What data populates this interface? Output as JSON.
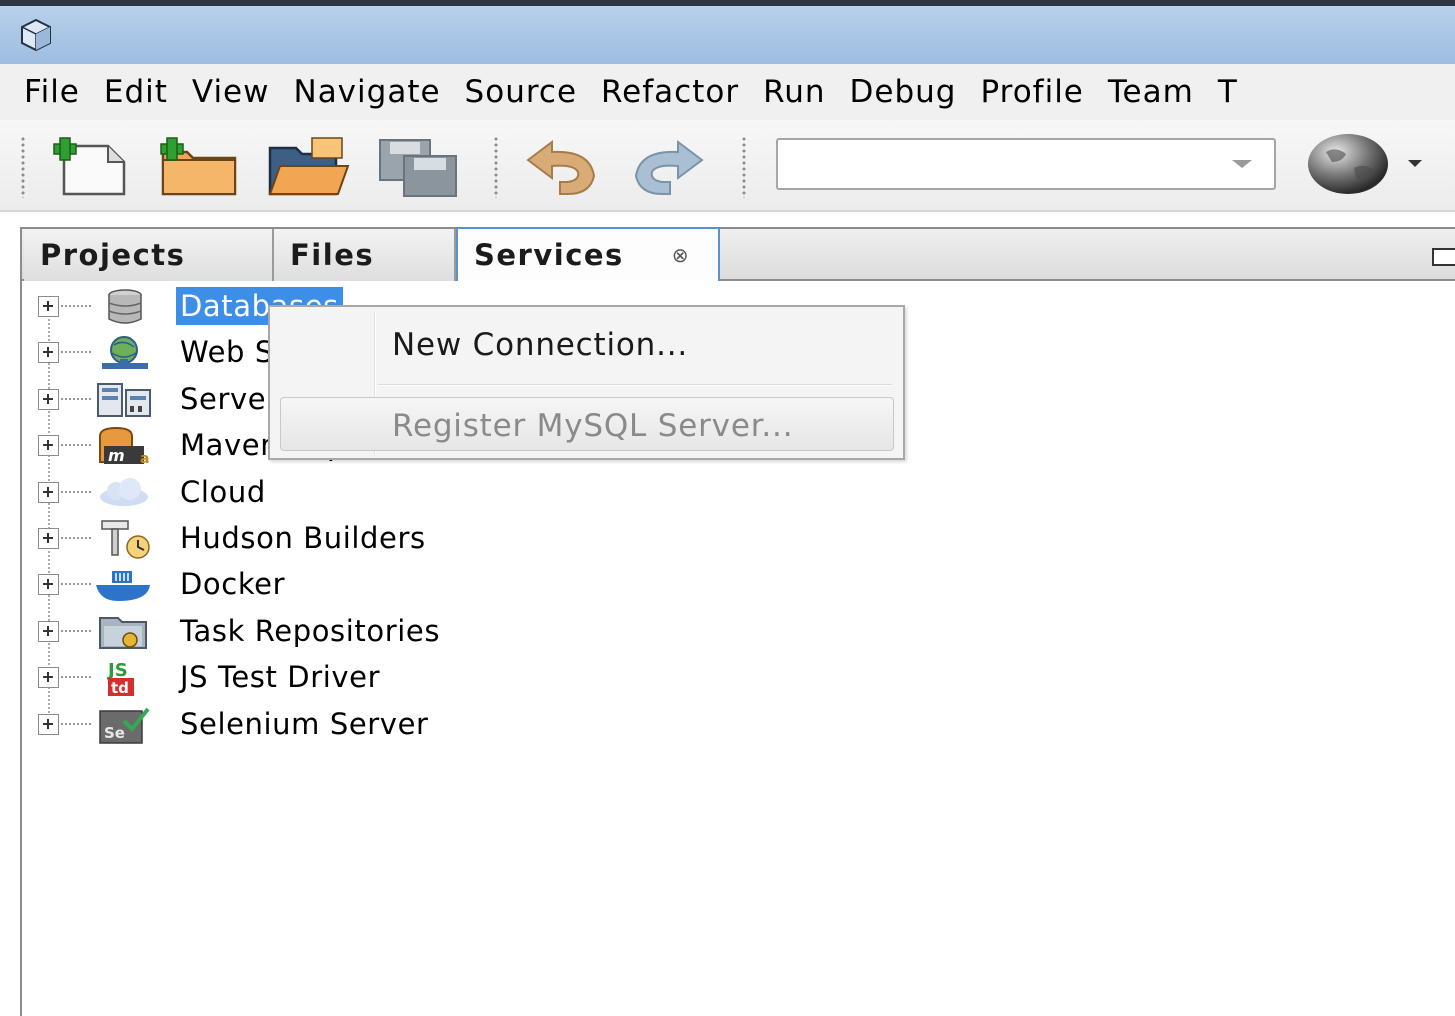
{
  "menubar": {
    "items": [
      "File",
      "Edit",
      "View",
      "Navigate",
      "Source",
      "Refactor",
      "Run",
      "Debug",
      "Profile",
      "Team",
      "T"
    ]
  },
  "toolbar": {
    "buttons": [
      "new-file-icon",
      "new-project-icon",
      "open-project-icon",
      "save-all-icon",
      "undo-icon",
      "redo-icon"
    ],
    "combo_value": "",
    "globe_icon": "browser-globe-icon"
  },
  "panel": {
    "tabs": [
      {
        "label": "Projects",
        "active": false
      },
      {
        "label": "Files",
        "active": false
      },
      {
        "label": "Services",
        "active": true,
        "close": "⊗"
      }
    ]
  },
  "tree": {
    "nodes": [
      {
        "label": "Databases",
        "icon": "database-icon",
        "selected": true
      },
      {
        "label": "Web Services",
        "icon": "web-services-icon"
      },
      {
        "label": "Servers",
        "icon": "servers-icon"
      },
      {
        "label": "Maven Repositories",
        "icon": "maven-icon"
      },
      {
        "label": "Cloud",
        "icon": "cloud-icon"
      },
      {
        "label": "Hudson Builders",
        "icon": "hudson-icon"
      },
      {
        "label": "Docker",
        "icon": "docker-icon"
      },
      {
        "label": "Task Repositories",
        "icon": "task-repositories-icon"
      },
      {
        "label": "JS Test Driver",
        "icon": "js-test-driver-icon"
      },
      {
        "label": "Selenium Server",
        "icon": "selenium-icon"
      }
    ]
  },
  "context_menu": {
    "items": [
      {
        "label": "New Connection...",
        "enabled": true
      },
      {
        "label": "Register MySQL Server...",
        "enabled": false
      }
    ]
  },
  "colors": {
    "selection": "#3d8ee6",
    "titlebar": "#a9c5e6",
    "active_tab_border": "#5a8fd0"
  }
}
